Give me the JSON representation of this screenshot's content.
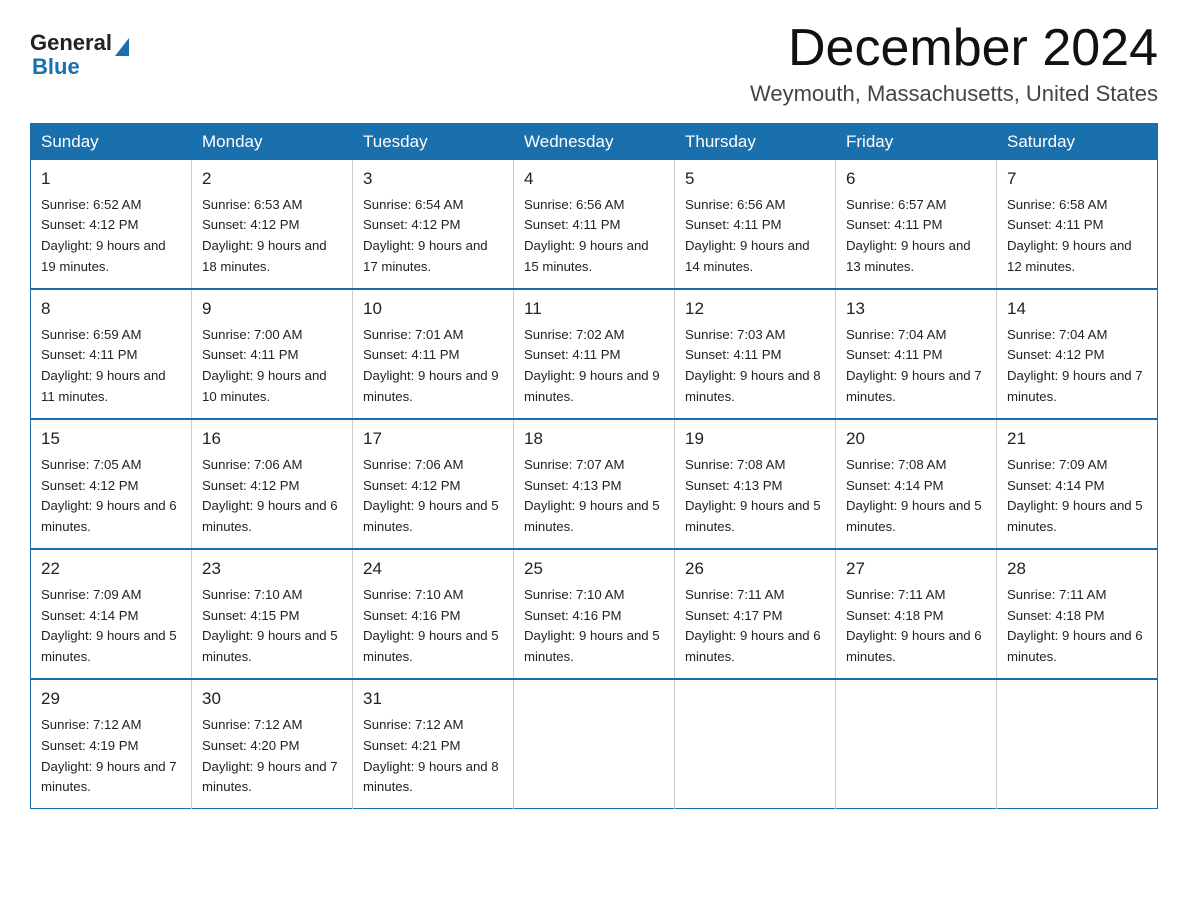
{
  "logo": {
    "general": "General",
    "blue": "Blue"
  },
  "title": "December 2024",
  "subtitle": "Weymouth, Massachusetts, United States",
  "days_of_week": [
    "Sunday",
    "Monday",
    "Tuesday",
    "Wednesday",
    "Thursday",
    "Friday",
    "Saturday"
  ],
  "weeks": [
    [
      {
        "day": "1",
        "sunrise": "6:52 AM",
        "sunset": "4:12 PM",
        "daylight": "9 hours and 19 minutes."
      },
      {
        "day": "2",
        "sunrise": "6:53 AM",
        "sunset": "4:12 PM",
        "daylight": "9 hours and 18 minutes."
      },
      {
        "day": "3",
        "sunrise": "6:54 AM",
        "sunset": "4:12 PM",
        "daylight": "9 hours and 17 minutes."
      },
      {
        "day": "4",
        "sunrise": "6:56 AM",
        "sunset": "4:11 PM",
        "daylight": "9 hours and 15 minutes."
      },
      {
        "day": "5",
        "sunrise": "6:56 AM",
        "sunset": "4:11 PM",
        "daylight": "9 hours and 14 minutes."
      },
      {
        "day": "6",
        "sunrise": "6:57 AM",
        "sunset": "4:11 PM",
        "daylight": "9 hours and 13 minutes."
      },
      {
        "day": "7",
        "sunrise": "6:58 AM",
        "sunset": "4:11 PM",
        "daylight": "9 hours and 12 minutes."
      }
    ],
    [
      {
        "day": "8",
        "sunrise": "6:59 AM",
        "sunset": "4:11 PM",
        "daylight": "9 hours and 11 minutes."
      },
      {
        "day": "9",
        "sunrise": "7:00 AM",
        "sunset": "4:11 PM",
        "daylight": "9 hours and 10 minutes."
      },
      {
        "day": "10",
        "sunrise": "7:01 AM",
        "sunset": "4:11 PM",
        "daylight": "9 hours and 9 minutes."
      },
      {
        "day": "11",
        "sunrise": "7:02 AM",
        "sunset": "4:11 PM",
        "daylight": "9 hours and 9 minutes."
      },
      {
        "day": "12",
        "sunrise": "7:03 AM",
        "sunset": "4:11 PM",
        "daylight": "9 hours and 8 minutes."
      },
      {
        "day": "13",
        "sunrise": "7:04 AM",
        "sunset": "4:11 PM",
        "daylight": "9 hours and 7 minutes."
      },
      {
        "day": "14",
        "sunrise": "7:04 AM",
        "sunset": "4:12 PM",
        "daylight": "9 hours and 7 minutes."
      }
    ],
    [
      {
        "day": "15",
        "sunrise": "7:05 AM",
        "sunset": "4:12 PM",
        "daylight": "9 hours and 6 minutes."
      },
      {
        "day": "16",
        "sunrise": "7:06 AM",
        "sunset": "4:12 PM",
        "daylight": "9 hours and 6 minutes."
      },
      {
        "day": "17",
        "sunrise": "7:06 AM",
        "sunset": "4:12 PM",
        "daylight": "9 hours and 5 minutes."
      },
      {
        "day": "18",
        "sunrise": "7:07 AM",
        "sunset": "4:13 PM",
        "daylight": "9 hours and 5 minutes."
      },
      {
        "day": "19",
        "sunrise": "7:08 AM",
        "sunset": "4:13 PM",
        "daylight": "9 hours and 5 minutes."
      },
      {
        "day": "20",
        "sunrise": "7:08 AM",
        "sunset": "4:14 PM",
        "daylight": "9 hours and 5 minutes."
      },
      {
        "day": "21",
        "sunrise": "7:09 AM",
        "sunset": "4:14 PM",
        "daylight": "9 hours and 5 minutes."
      }
    ],
    [
      {
        "day": "22",
        "sunrise": "7:09 AM",
        "sunset": "4:14 PM",
        "daylight": "9 hours and 5 minutes."
      },
      {
        "day": "23",
        "sunrise": "7:10 AM",
        "sunset": "4:15 PM",
        "daylight": "9 hours and 5 minutes."
      },
      {
        "day": "24",
        "sunrise": "7:10 AM",
        "sunset": "4:16 PM",
        "daylight": "9 hours and 5 minutes."
      },
      {
        "day": "25",
        "sunrise": "7:10 AM",
        "sunset": "4:16 PM",
        "daylight": "9 hours and 5 minutes."
      },
      {
        "day": "26",
        "sunrise": "7:11 AM",
        "sunset": "4:17 PM",
        "daylight": "9 hours and 6 minutes."
      },
      {
        "day": "27",
        "sunrise": "7:11 AM",
        "sunset": "4:18 PM",
        "daylight": "9 hours and 6 minutes."
      },
      {
        "day": "28",
        "sunrise": "7:11 AM",
        "sunset": "4:18 PM",
        "daylight": "9 hours and 6 minutes."
      }
    ],
    [
      {
        "day": "29",
        "sunrise": "7:12 AM",
        "sunset": "4:19 PM",
        "daylight": "9 hours and 7 minutes."
      },
      {
        "day": "30",
        "sunrise": "7:12 AM",
        "sunset": "4:20 PM",
        "daylight": "9 hours and 7 minutes."
      },
      {
        "day": "31",
        "sunrise": "7:12 AM",
        "sunset": "4:21 PM",
        "daylight": "9 hours and 8 minutes."
      },
      null,
      null,
      null,
      null
    ]
  ]
}
